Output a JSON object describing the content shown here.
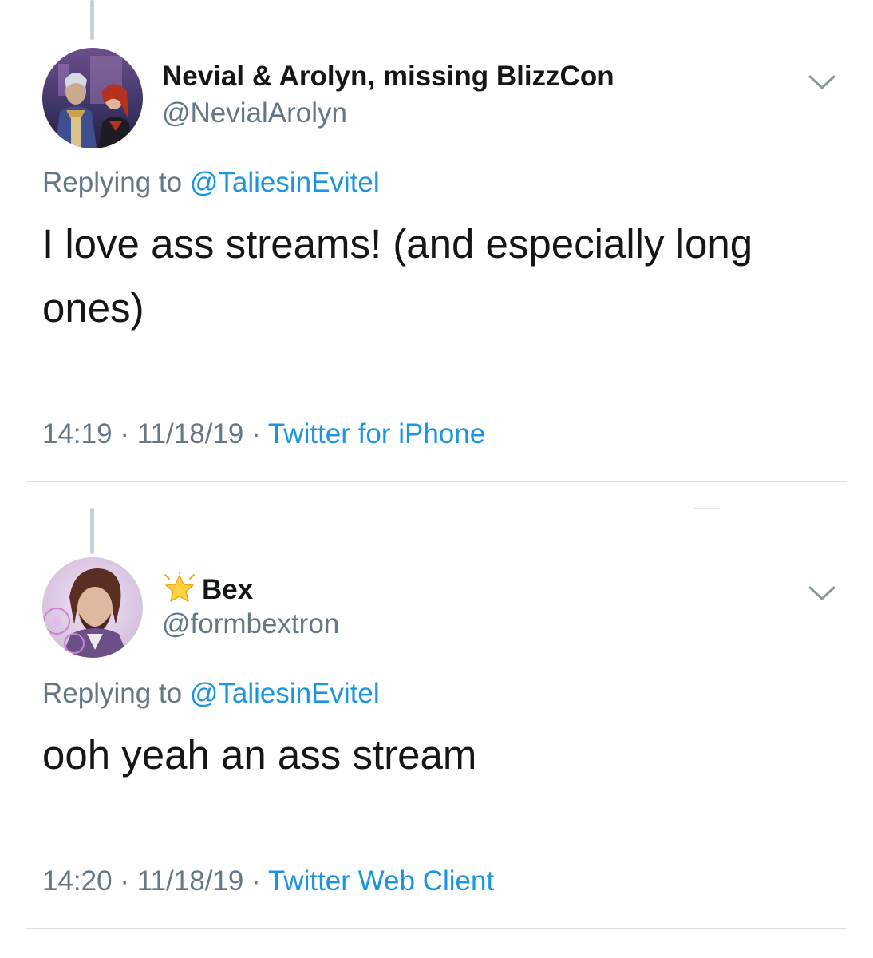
{
  "tweets": [
    {
      "display_name": "Nevial & Arolyn, missing BlizzCon",
      "handle": "@NevialArolyn",
      "replying_prefix": "Replying to ",
      "replying_to": "@TaliesinEvitel",
      "text": "I love ass streams! (and especially long ones)",
      "time": "14:19",
      "date": "11/18/19",
      "separator": " · ",
      "source": "Twitter for iPhone",
      "avatar_icon": "avatar-image",
      "menu_icon": "chevron-down-icon"
    },
    {
      "display_name": "Bex",
      "name_badge_icon": "glowing-star-icon",
      "handle": "@formbextron",
      "replying_prefix": "Replying to ",
      "replying_to": "@TaliesinEvitel",
      "text": "ooh yeah an ass stream",
      "time": "14:20",
      "date": "11/18/19",
      "separator": " · ",
      "source": "Twitter Web Client",
      "avatar_icon": "avatar-image",
      "menu_icon": "chevron-down-icon"
    }
  ],
  "colors": {
    "link": "#1b95e0",
    "secondary_text": "#657786",
    "primary_text": "#14171a",
    "divider": "#dce1e5",
    "thread_line": "#c9d1d8"
  }
}
